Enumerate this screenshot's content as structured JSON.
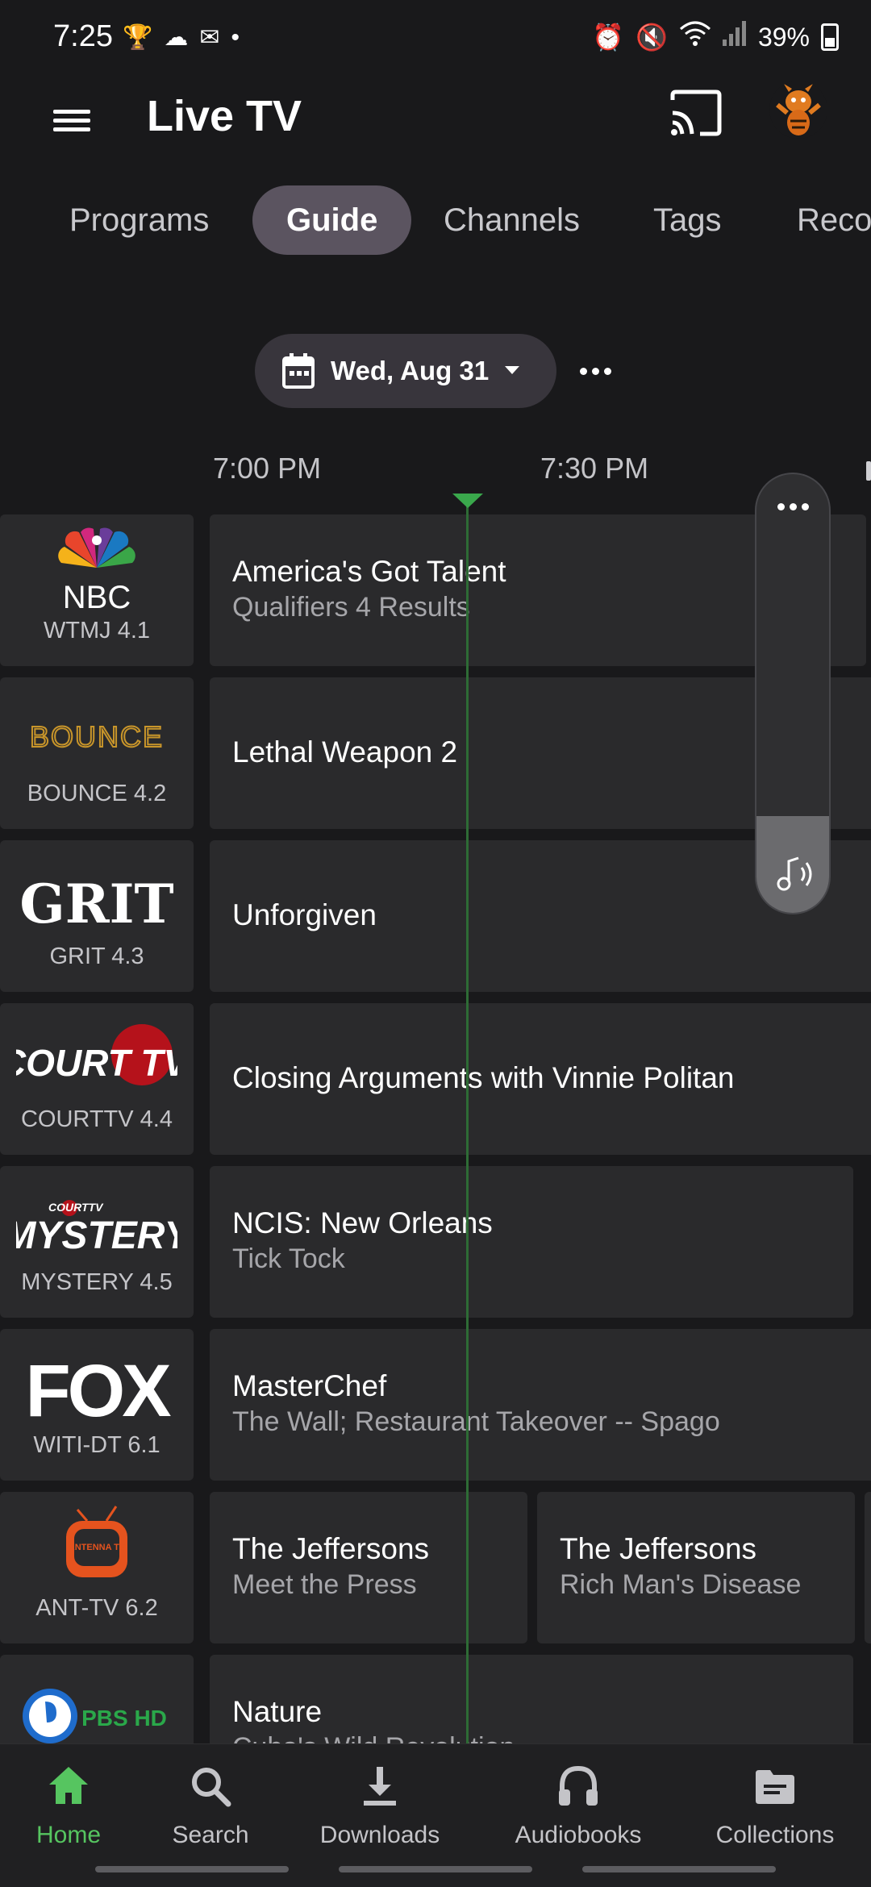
{
  "status_bar": {
    "time": "7:25",
    "battery": "39%"
  },
  "app_bar": {
    "title": "Live TV"
  },
  "tabs": [
    {
      "label": "Programs",
      "active": false
    },
    {
      "label": "Guide",
      "active": true
    },
    {
      "label": "Channels",
      "active": false
    },
    {
      "label": "Tags",
      "active": false
    },
    {
      "label": "Reco",
      "active": false
    }
  ],
  "date_selector": {
    "date": "Wed, Aug 31"
  },
  "timeline": {
    "times": [
      "7:00 PM",
      "7:30 PM"
    ]
  },
  "channels": [
    {
      "logo_text": "NBC",
      "number": "WTMJ 4.1",
      "programs": [
        {
          "title": "America's Got Talent",
          "subtitle": "Qualifiers 4 Results"
        }
      ]
    },
    {
      "logo_text": "BOUNCE",
      "number": "BOUNCE 4.2",
      "programs": [
        {
          "title": "Lethal Weapon 2",
          "subtitle": ""
        }
      ]
    },
    {
      "logo_text": "GRIT",
      "number": "GRIT 4.3",
      "programs": [
        {
          "title": "Unforgiven",
          "subtitle": ""
        }
      ]
    },
    {
      "logo_text": "COURT TV",
      "number": "COURTTV 4.4",
      "programs": [
        {
          "title": "Closing Arguments with Vinnie Politan",
          "subtitle": ""
        }
      ]
    },
    {
      "logo_text": "MYSTERY",
      "logo_small_text": "COURTTV",
      "number": "MYSTERY 4.5",
      "programs": [
        {
          "title": "NCIS: New Orleans",
          "subtitle": "Tick Tock"
        }
      ]
    },
    {
      "logo_text": "FOX",
      "number": "WITI-DT 6.1",
      "programs": [
        {
          "title": "MasterChef",
          "subtitle": "The Wall; Restaurant Takeover -- Spago"
        }
      ]
    },
    {
      "logo_text": "ANTENNA TV",
      "number": "ANT-TV 6.2",
      "programs": [
        {
          "title": "The Jeffersons",
          "subtitle": "Meet the Press"
        },
        {
          "title": "The Jeffersons",
          "subtitle": "Rich Man's Disease"
        }
      ]
    },
    {
      "logo_text": "PBS HD",
      "number": "",
      "programs": [
        {
          "title": "Nature",
          "subtitle": "Cuba's Wild Revolution"
        }
      ]
    }
  ],
  "volume": {
    "level": 0.22
  },
  "bottom_nav": [
    {
      "label": "Home",
      "icon": "home-icon",
      "active": true
    },
    {
      "label": "Search",
      "icon": "search-icon",
      "active": false
    },
    {
      "label": "Downloads",
      "icon": "download-icon",
      "active": false
    },
    {
      "label": "Audiobooks",
      "icon": "headphones-icon",
      "active": false
    },
    {
      "label": "Collections",
      "icon": "collections-icon",
      "active": false
    }
  ],
  "colors": {
    "accent": "#56c560",
    "now_line": "#2e6b35",
    "background": "#19191b",
    "cell": "#2a2a2c",
    "active_tab": "#5b5460"
  }
}
